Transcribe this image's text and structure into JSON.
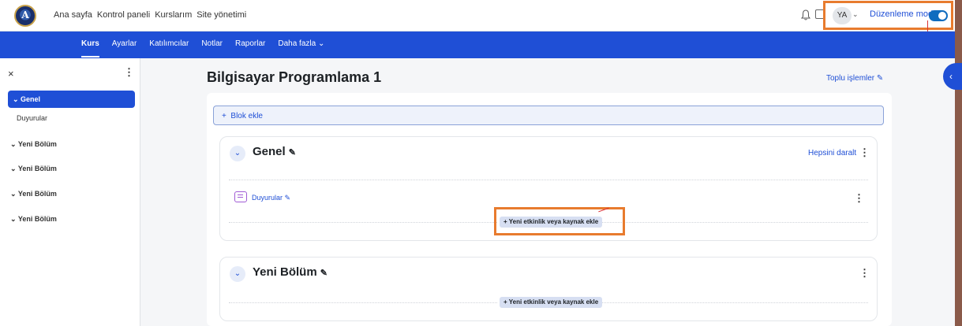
{
  "topnav": {
    "links": [
      "Ana sayfa",
      "Kontrol paneli",
      "Kurslarım",
      "Site yönetimi"
    ],
    "avatar": "YA",
    "edit_mode_label": "Düzenleme modu",
    "edit_mode_on": true
  },
  "subnav": {
    "items": [
      "Kurs",
      "Ayarlar",
      "Katılımcılar",
      "Notlar",
      "Raporlar",
      "Daha fazla ⌄"
    ],
    "active": "Kurs"
  },
  "drawer": {
    "close": "×",
    "kebab": "⋮",
    "items": [
      {
        "label": "⌄ Genel"
      },
      {
        "label": "Duyurular"
      },
      {
        "label": "⌄ Yeni Bölüm"
      },
      {
        "label": "⌄ Yeni Bölüm"
      },
      {
        "label": "⌄ Yeni Bölüm"
      },
      {
        "label": "⌄ Yeni Bölüm"
      }
    ]
  },
  "main": {
    "title": "Bilgisayar Programlama 1",
    "bulk_label": "Toplu işlemler",
    "add_block_label": "Blok ekle",
    "sections": [
      {
        "title": "Genel",
        "collapse_all": "Hepsini daralt",
        "activities": [
          {
            "label": "Duyurular"
          }
        ],
        "add_activity": "Yeni etkinlik veya kaynak ekle"
      },
      {
        "title": "Yeni Bölüm",
        "add_activity": "Yeni etkinlik veya kaynak ekle"
      }
    ]
  },
  "colors": {
    "primary": "#1f4fd6",
    "highlight": "#e87b2e",
    "forum": "#a05bd5"
  }
}
